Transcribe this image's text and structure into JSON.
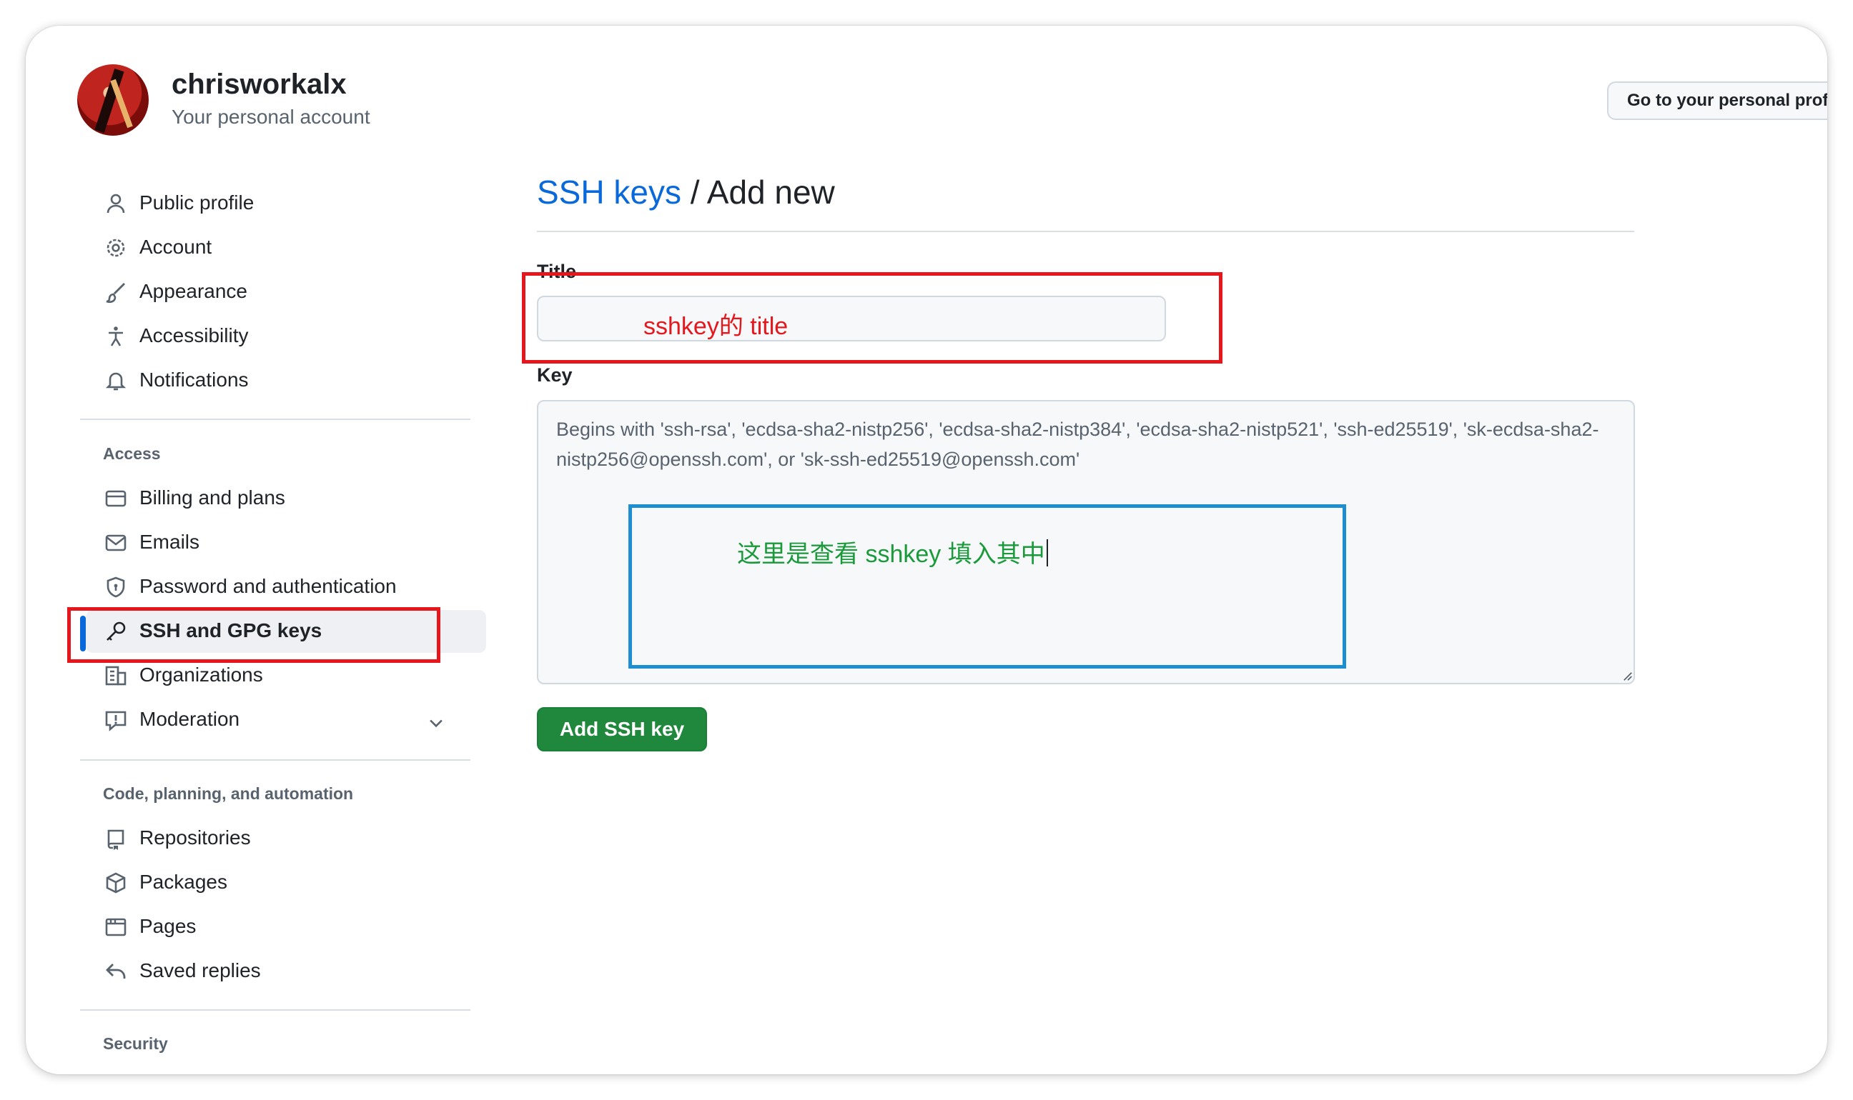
{
  "account": {
    "username": "chrisworkalx",
    "subtitle": "Your personal account",
    "go_profile_button": "Go to your personal prof"
  },
  "sidebar": {
    "top_items": [
      {
        "label": "Public profile",
        "icon": "person-icon"
      },
      {
        "label": "Account",
        "icon": "gear-icon"
      },
      {
        "label": "Appearance",
        "icon": "paintbrush-icon"
      },
      {
        "label": "Accessibility",
        "icon": "accessibility-icon"
      },
      {
        "label": "Notifications",
        "icon": "bell-icon"
      }
    ],
    "access_header": "Access",
    "access_items": [
      {
        "label": "Billing and plans",
        "icon": "credit-card-icon"
      },
      {
        "label": "Emails",
        "icon": "mail-icon"
      },
      {
        "label": "Password and authentication",
        "icon": "shield-lock-icon"
      },
      {
        "label": "SSH and GPG keys",
        "icon": "key-icon",
        "active": true
      },
      {
        "label": "Organizations",
        "icon": "organization-icon"
      },
      {
        "label": "Moderation",
        "icon": "report-icon",
        "expandable": true
      }
    ],
    "code_header": "Code, planning, and automation",
    "code_items": [
      {
        "label": "Repositories",
        "icon": "repo-icon"
      },
      {
        "label": "Packages",
        "icon": "package-icon"
      },
      {
        "label": "Pages",
        "icon": "browser-icon"
      },
      {
        "label": "Saved replies",
        "icon": "reply-icon"
      }
    ],
    "security_header": "Security"
  },
  "main": {
    "breadcrumb_link": "SSH keys",
    "breadcrumb_rest": " / Add new",
    "title_label": "Title",
    "title_value": "sshkey的 title",
    "key_label": "Key",
    "key_placeholder": "Begins with 'ssh-rsa', 'ecdsa-sha2-nistp256', 'ecdsa-sha2-nistp384', 'ecdsa-sha2-nistp521', 'ssh-ed25519', 'sk-ecdsa-sha2-nistp256@openssh.com', or 'sk-ssh-ed25519@openssh.com'",
    "key_annotation": "这里是查看 sshkey 填入其中",
    "submit_button": "Add SSH key"
  },
  "colors": {
    "accent_blue": "#0969da",
    "primary_green": "#1f883d",
    "annotation_red": "#e5171c",
    "annotation_blue": "#1d8fd0",
    "annotation_green": "#1a9a3a"
  }
}
